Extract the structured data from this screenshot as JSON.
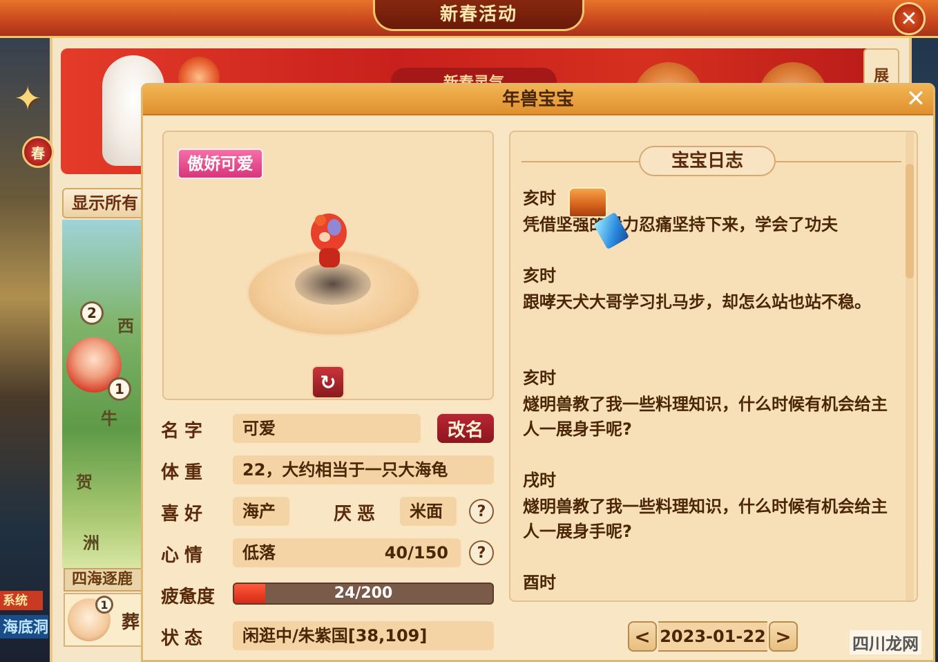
{
  "outer_window": {
    "title": "新春活动",
    "banner_tab": "新春灵气",
    "side_tab": "展",
    "spring_badge": "春",
    "show_all_label": "显示所有",
    "region_label": "四海逐鹿",
    "region_card_text": "葬",
    "left_badge_1": "系统",
    "left_badge_2": "海底洞",
    "map_pins": [
      "2",
      "1"
    ],
    "map_text": [
      "西",
      "牛",
      "贺",
      "洲"
    ],
    "region_card_pin": "1"
  },
  "dialog": {
    "title": "年兽宝宝",
    "close_icon": "close-icon"
  },
  "pet": {
    "trait_badge": "傲娇可爱",
    "rotate_icon": "rotate-icon",
    "rows": {
      "name": {
        "label": "名字",
        "value": "可爱",
        "rename_label": "改名"
      },
      "weight": {
        "label": "体重",
        "value": "22，大约相当于一只大海龟"
      },
      "likes": {
        "label": "喜好",
        "value": "海产",
        "dislike_label": "厌恶",
        "dislike_value": "米面"
      },
      "mood": {
        "label": "心情",
        "value": "低落",
        "count": "40/150"
      },
      "fatigue": {
        "label": "疲惫度",
        "text": "24/200",
        "current": 24,
        "max": 200
      },
      "status": {
        "label": "状态",
        "value": "闲逛中/朱紫国[38,109]"
      }
    },
    "help_label": "?"
  },
  "journal": {
    "title": "宝宝日志",
    "entries": [
      {
        "time": "亥时",
        "text": "凭借坚强的毅力忍痛坚持下来，学会了功夫"
      },
      {
        "time": "亥时",
        "text": "跟哮天犬大哥学习扎马步，却怎么站也站不稳。"
      },
      {
        "time": "亥时",
        "text": "燧明兽教了我一些料理知识，什么时候有机会给主人一展身手呢?"
      },
      {
        "time": "戌时",
        "text": "燧明兽教了我一些料理知识，什么时候有机会给主人一展身手呢?"
      },
      {
        "time": "酉时",
        "text": ""
      }
    ],
    "date": "2023-01-22",
    "prev_label": "<",
    "next_label": ">"
  },
  "watermark": "四川龙网",
  "colors": {
    "accent_red": "#b82632",
    "panel": "#f8e6c5",
    "header_orange": "#e0902e",
    "fatigue_fill": "#ff5a3a"
  }
}
